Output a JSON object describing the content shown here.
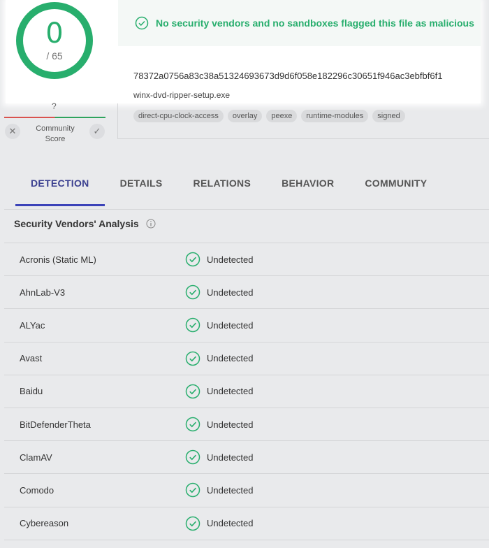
{
  "score": {
    "detections": "0",
    "total": "/ 65"
  },
  "banner": {
    "text": "No security vendors and no sandboxes flagged this file as malicious"
  },
  "file": {
    "hash": "78372a0756a83c38a51324693673d9d6f058e182296c30651f946ac3ebfbf6f1",
    "name": "winx-dvd-ripper-setup.exe",
    "tags": [
      "direct-cpu-clock-access",
      "overlay",
      "peexe",
      "runtime-modules",
      "signed"
    ]
  },
  "community": {
    "value": "?",
    "label_line1": "Community",
    "label_line2": "Score",
    "downvote": "✕",
    "upvote": "✓"
  },
  "tabs": [
    "DETECTION",
    "DETAILS",
    "RELATIONS",
    "BEHAVIOR",
    "COMMUNITY"
  ],
  "section": {
    "title": "Security Vendors' Analysis"
  },
  "vendors": [
    {
      "name": "Acronis (Static ML)",
      "result": "Undetected"
    },
    {
      "name": "AhnLab-V3",
      "result": "Undetected"
    },
    {
      "name": "ALYac",
      "result": "Undetected"
    },
    {
      "name": "Avast",
      "result": "Undetected"
    },
    {
      "name": "Baidu",
      "result": "Undetected"
    },
    {
      "name": "BitDefenderTheta",
      "result": "Undetected"
    },
    {
      "name": "ClamAV",
      "result": "Undetected"
    },
    {
      "name": "Comodo",
      "result": "Undetected"
    },
    {
      "name": "Cybereason",
      "result": "Undetected"
    }
  ],
  "colors": {
    "clean": "#28ae6d",
    "tab_active": "#3b43b8"
  }
}
